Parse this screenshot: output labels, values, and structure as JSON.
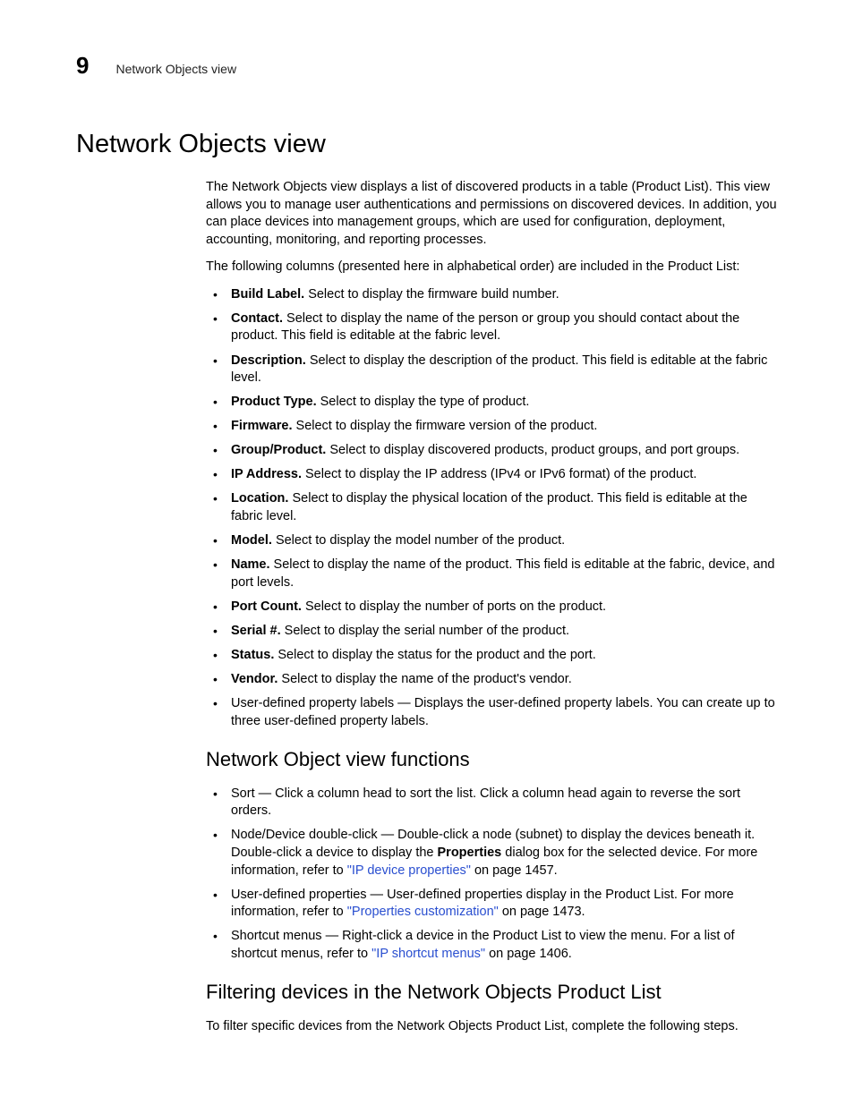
{
  "header": {
    "chapter": "9",
    "running_head": "Network Objects view"
  },
  "title": "Network Objects view",
  "intro_p1": "The Network Objects view displays a list of discovered products in a table (Product List). This view allows you to manage user authentications and permissions on discovered devices. In addition, you can place devices into management groups, which are used for configuration, deployment, accounting, monitoring, and reporting processes.",
  "intro_p2": "The following columns (presented here in alphabetical order) are included in the Product List:",
  "columns": [
    {
      "term": "Build Label.",
      "desc": " Select to display the firmware build number."
    },
    {
      "term": "Contact.",
      "desc": " Select to display the name of the person or group you should contact about the product. This field is editable at the fabric level."
    },
    {
      "term": "Description.",
      "desc": " Select to display the description of the product. This field is editable at the fabric level."
    },
    {
      "term": "Product Type.",
      "desc": " Select to display the type of product."
    },
    {
      "term": "Firmware.",
      "desc": " Select to display the firmware version of the product."
    },
    {
      "term": "Group/Product.",
      "desc": " Select to display discovered products, product groups, and port groups."
    },
    {
      "term": "IP Address.",
      "desc": " Select to display the IP address (IPv4 or IPv6 format) of the product."
    },
    {
      "term": "Location.",
      "desc": " Select to display the physical location of the product. This field is editable at the fabric level."
    },
    {
      "term": "Model.",
      "desc": " Select to display the model number of the product."
    },
    {
      "term": "Name.",
      "desc": " Select to display the name of the product. This field is editable at the fabric, device, and port levels."
    },
    {
      "term": "Port Count.",
      "desc": " Select to display the number of ports on the product."
    },
    {
      "term": "Serial #.",
      "desc": " Select to display the serial number of the product."
    },
    {
      "term": "Status.",
      "desc": " Select to display the status for the product and the port."
    },
    {
      "term": "Vendor.",
      "desc": " Select to display the name of the product's vendor."
    },
    {
      "term": "",
      "desc": "User-defined property labels — Displays the user-defined property labels. You can create up to three user-defined property labels."
    }
  ],
  "sub1_title": "Network Object view functions",
  "functions": {
    "f0": "Sort — Click a column head to sort the list. Click a column head again to reverse the sort orders.",
    "f1_a": "Node/Device double-click — Double-click a node (subnet) to display the devices beneath it. Double-click a device to display the ",
    "f1_bold": "Properties",
    "f1_b": " dialog box for the selected device. For more information, refer to ",
    "f1_link": "\"IP device properties\"",
    "f1_c": " on page 1457.",
    "f2_a": "User-defined properties — User-defined properties display in the Product List. For more information, refer to ",
    "f2_link": "\"Properties customization\"",
    "f2_b": " on page 1473.",
    "f3_a": "Shortcut menus — Right-click a device in the Product List to view the menu. For a list of shortcut menus, refer to ",
    "f3_link": "\"IP shortcut menus\"",
    "f3_b": " on page 1406."
  },
  "sub2_title": "Filtering devices in the Network Objects Product List",
  "filter_p": "To filter specific devices from the Network Objects Product List, complete the following steps."
}
